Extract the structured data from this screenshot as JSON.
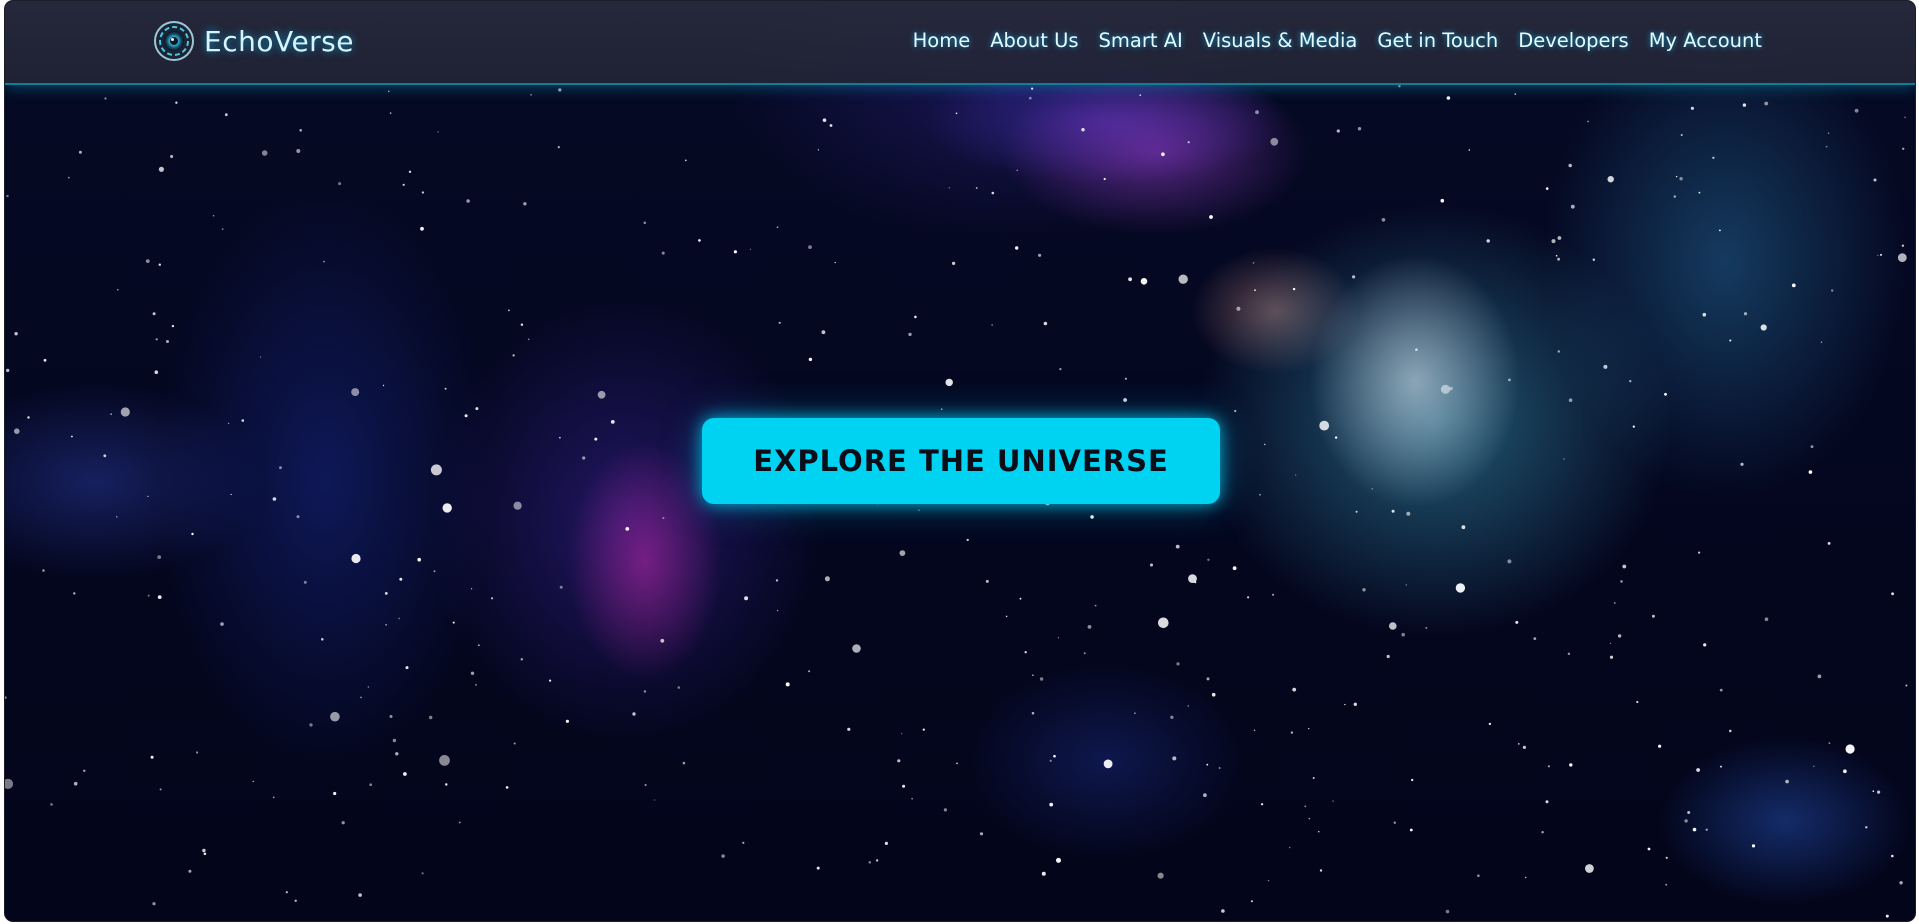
{
  "brand": {
    "name": "EchoVerse",
    "logo_icon": "orb-eye-icon"
  },
  "nav": {
    "items": [
      {
        "label": "Home"
      },
      {
        "label": "About Us"
      },
      {
        "label": "Smart AI"
      },
      {
        "label": "Visuals & Media"
      },
      {
        "label": "Get in Touch"
      },
      {
        "label": "Developers"
      },
      {
        "label": "My Account"
      }
    ]
  },
  "hero": {
    "cta_label": "EXPLORE THE UNIVERSE",
    "background": "starfield-nebula-image"
  },
  "colors": {
    "accent": "#00d2f2",
    "navbar": "#262838",
    "nav_text": "#e8f9ff",
    "background": "#040720"
  }
}
